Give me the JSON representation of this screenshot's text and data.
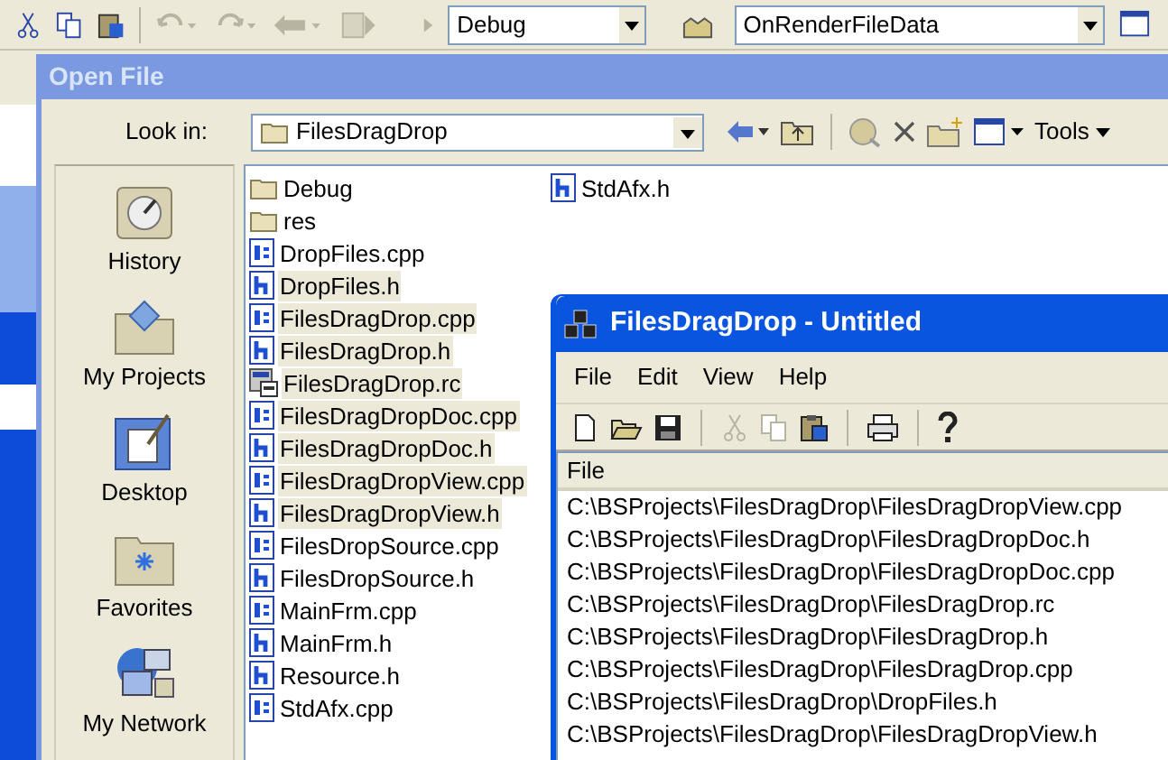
{
  "ide_toolbar": {
    "config_combo": "Debug",
    "function_combo": "OnRenderFileData"
  },
  "open_file_dialog": {
    "title": "Open File",
    "active": false,
    "look_in_label": "Look in:",
    "look_in_value": "FilesDragDrop",
    "tools_label": "Tools",
    "places": [
      "History",
      "My Projects",
      "Desktop",
      "Favorites",
      "My Network"
    ],
    "files": [
      {
        "name": "Debug",
        "kind": "folder",
        "selected": false
      },
      {
        "name": "res",
        "kind": "folder",
        "selected": false
      },
      {
        "name": "DropFiles.cpp",
        "kind": "cpp",
        "selected": false
      },
      {
        "name": "DropFiles.h",
        "kind": "h",
        "selected": true
      },
      {
        "name": "FilesDragDrop.cpp",
        "kind": "cpp",
        "selected": true
      },
      {
        "name": "FilesDragDrop.h",
        "kind": "h",
        "selected": true
      },
      {
        "name": "FilesDragDrop.rc",
        "kind": "rc",
        "selected": true
      },
      {
        "name": "FilesDragDropDoc.cpp",
        "kind": "cpp",
        "selected": true
      },
      {
        "name": "FilesDragDropDoc.h",
        "kind": "h",
        "selected": true
      },
      {
        "name": "FilesDragDropView.cpp",
        "kind": "cpp",
        "selected": true
      },
      {
        "name": "FilesDragDropView.h",
        "kind": "h",
        "selected": true
      },
      {
        "name": "FilesDropSource.cpp",
        "kind": "cpp",
        "selected": false
      },
      {
        "name": "FilesDropSource.h",
        "kind": "h",
        "selected": false
      },
      {
        "name": "MainFrm.cpp",
        "kind": "cpp",
        "selected": false
      },
      {
        "name": "MainFrm.h",
        "kind": "h",
        "selected": false
      },
      {
        "name": "Resource.h",
        "kind": "h",
        "selected": false
      },
      {
        "name": "StdAfx.cpp",
        "kind": "cpp",
        "selected": false
      },
      {
        "name": "StdAfx.h",
        "kind": "h",
        "selected": false
      }
    ]
  },
  "app_window": {
    "title": "FilesDragDrop - Untitled",
    "active": true,
    "menu": [
      "File",
      "Edit",
      "View",
      "Help"
    ],
    "toolbar": [
      {
        "kind": "new",
        "disabled": false
      },
      {
        "kind": "open",
        "disabled": false
      },
      {
        "kind": "save",
        "disabled": false
      },
      {
        "kind": "separator"
      },
      {
        "kind": "cut",
        "disabled": true
      },
      {
        "kind": "copy",
        "disabled": true
      },
      {
        "kind": "paste",
        "disabled": false
      },
      {
        "kind": "separator"
      },
      {
        "kind": "print",
        "disabled": false
      },
      {
        "kind": "separator"
      },
      {
        "kind": "help",
        "disabled": false
      }
    ],
    "list_header": "File",
    "rows": [
      "C:\\BSProjects\\FilesDragDrop\\FilesDragDropView.cpp",
      "C:\\BSProjects\\FilesDragDrop\\FilesDragDropDoc.h",
      "C:\\BSProjects\\FilesDragDrop\\FilesDragDropDoc.cpp",
      "C:\\BSProjects\\FilesDragDrop\\FilesDragDrop.rc",
      "C:\\BSProjects\\FilesDragDrop\\FilesDragDrop.h",
      "C:\\BSProjects\\FilesDragDrop\\FilesDragDrop.cpp",
      "C:\\BSProjects\\FilesDragDrop\\DropFiles.h",
      "C:\\BSProjects\\FilesDragDrop\\FilesDragDropView.h"
    ]
  }
}
